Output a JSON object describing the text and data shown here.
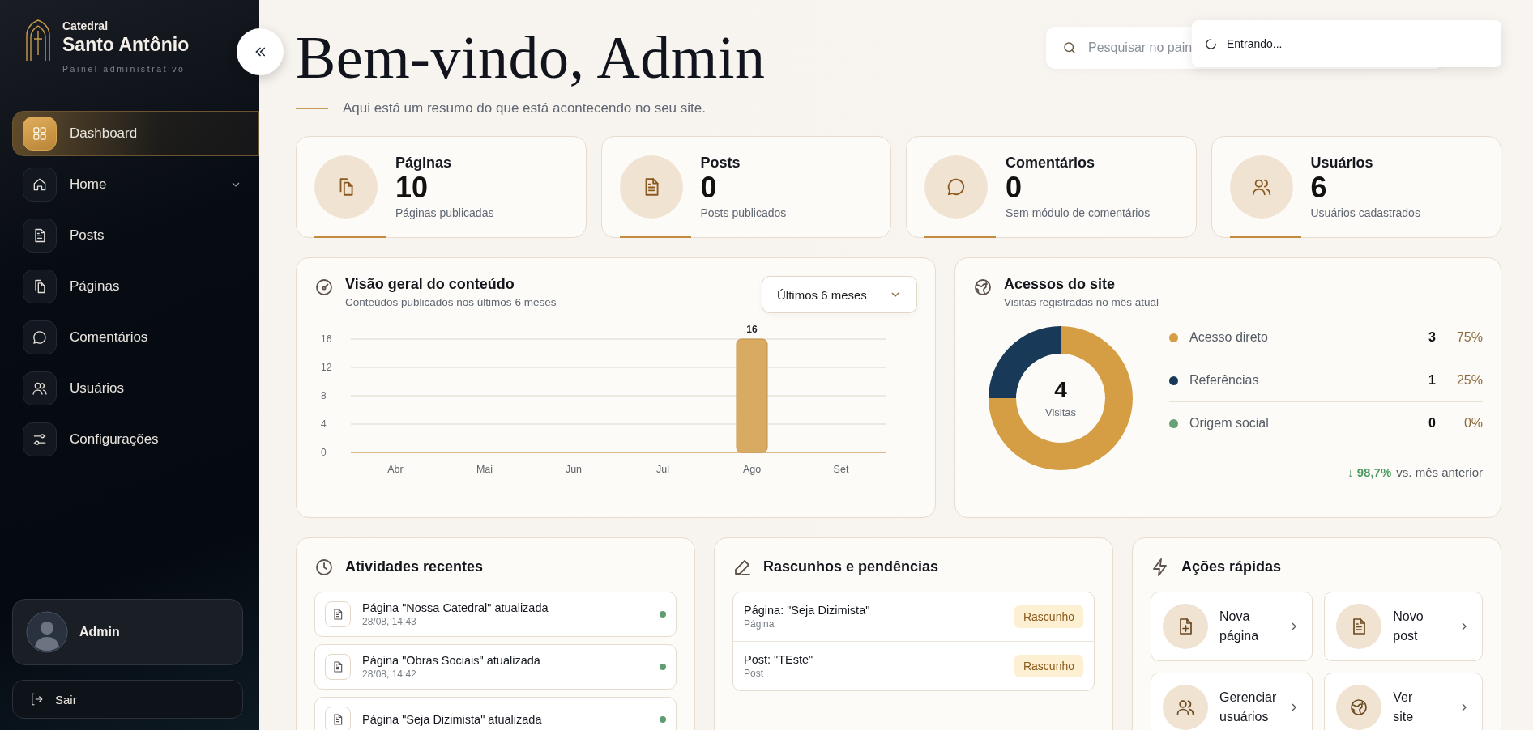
{
  "sidebar": {
    "brand": {
      "overline": "Catedral",
      "name": "Santo Antônio",
      "subtitle": "Painel administrativo"
    },
    "items": [
      {
        "label": "Dashboard",
        "kind": "grid",
        "selected": true,
        "has_submenu": false
      },
      {
        "label": "Home",
        "kind": "home",
        "selected": false,
        "has_submenu": true
      },
      {
        "label": "Posts",
        "kind": "file",
        "selected": false,
        "has_submenu": false
      },
      {
        "label": "Páginas",
        "kind": "pages",
        "selected": false,
        "has_submenu": false
      },
      {
        "label": "Comentários",
        "kind": "chat",
        "selected": false,
        "has_submenu": false
      },
      {
        "label": "Usuários",
        "kind": "users",
        "selected": false,
        "has_submenu": false
      },
      {
        "label": "Configurações",
        "kind": "sliders",
        "selected": false,
        "has_submenu": false
      }
    ],
    "user": {
      "name": "Admin"
    },
    "logout": "Sair"
  },
  "header": {
    "title": "Bem-vindo, Admin",
    "subtitle": "Aqui está um resumo do que está acontecendo no seu site.",
    "search": {
      "placeholder": "Pesquisar no pain"
    }
  },
  "toast": {
    "text": "Entrando..."
  },
  "stats": [
    {
      "kind": "pages",
      "label": "Páginas",
      "value": "10",
      "caption": "Páginas publicadas"
    },
    {
      "kind": "file",
      "label": "Posts",
      "value": "0",
      "caption": "Posts publicados"
    },
    {
      "kind": "chat",
      "label": "Comentários",
      "value": "0",
      "caption": "Sem módulo de comentários"
    },
    {
      "kind": "users",
      "label": "Usuários",
      "value": "6",
      "caption": "Usuários cadastrados"
    }
  ],
  "content_overview": {
    "title": "Visão geral do conteúdo",
    "subtitle": "Conteúdos publicados nos últimos 6 meses",
    "period": "Últimos 6 meses",
    "chart_data": {
      "type": "bar",
      "categories": [
        "Abr",
        "Mai",
        "Jun",
        "Jul",
        "Ago",
        "Set"
      ],
      "series": [
        {
          "color": "#d9ab62",
          "values": [
            0,
            0,
            0,
            0,
            16,
            0
          ]
        }
      ],
      "ylim": [
        0,
        16
      ],
      "yticks": [
        0,
        4,
        8,
        12,
        16
      ],
      "grid": true,
      "value_labels": [
        null,
        null,
        null,
        null,
        "16",
        null
      ]
    }
  },
  "site_access": {
    "title": "Acessos do site",
    "subtitle": "Visitas registradas no mês atual",
    "total": "4",
    "total_label": "Visitas",
    "chart_data": {
      "type": "donut",
      "categories": [
        "Acesso direto",
        "Referências",
        "Origem social"
      ],
      "values": [
        75,
        25,
        0
      ]
    },
    "legend": [
      {
        "count": "3",
        "percent": "75%",
        "color": "#d69e44"
      },
      {
        "count": "1",
        "percent": "25%",
        "color": "#183a58"
      },
      {
        "count": "0",
        "percent": "0%",
        "color": "#65a276"
      }
    ],
    "trend": {
      "value": "↓ 98,7%",
      "text": "vs. mês anterior"
    }
  },
  "recent_activity": {
    "title": "Atividades recentes",
    "items": [
      {
        "title": "Página \"Nossa Catedral\" atualizada",
        "time": "28/08, 14:43",
        "color": "#5e9e72"
      },
      {
        "title": "Página \"Obras Sociais\" atualizada",
        "time": "28/08, 14:42",
        "color": "#5e9e72"
      },
      {
        "title": "Página \"Seja Dizimista\" atualizada",
        "color": "#5e9e72"
      }
    ]
  },
  "drafts": {
    "title": "Rascunhos e pendências",
    "items": [
      {
        "title": "Página: \"Seja Dizimista\"",
        "type": "Página",
        "status": "Rascunho"
      },
      {
        "title": "Post: \"TEste\"",
        "type": "Post",
        "status": "Rascunho"
      }
    ]
  },
  "quick_actions": {
    "title": "Ações rápidas",
    "items": [
      {
        "kind": "file-plus",
        "label": "Nova página"
      },
      {
        "kind": "file",
        "label": "Novo post"
      },
      {
        "kind": "users",
        "label": "Gerenciar usuários"
      },
      {
        "kind": "globe",
        "label": "Ver site"
      }
    ]
  }
}
